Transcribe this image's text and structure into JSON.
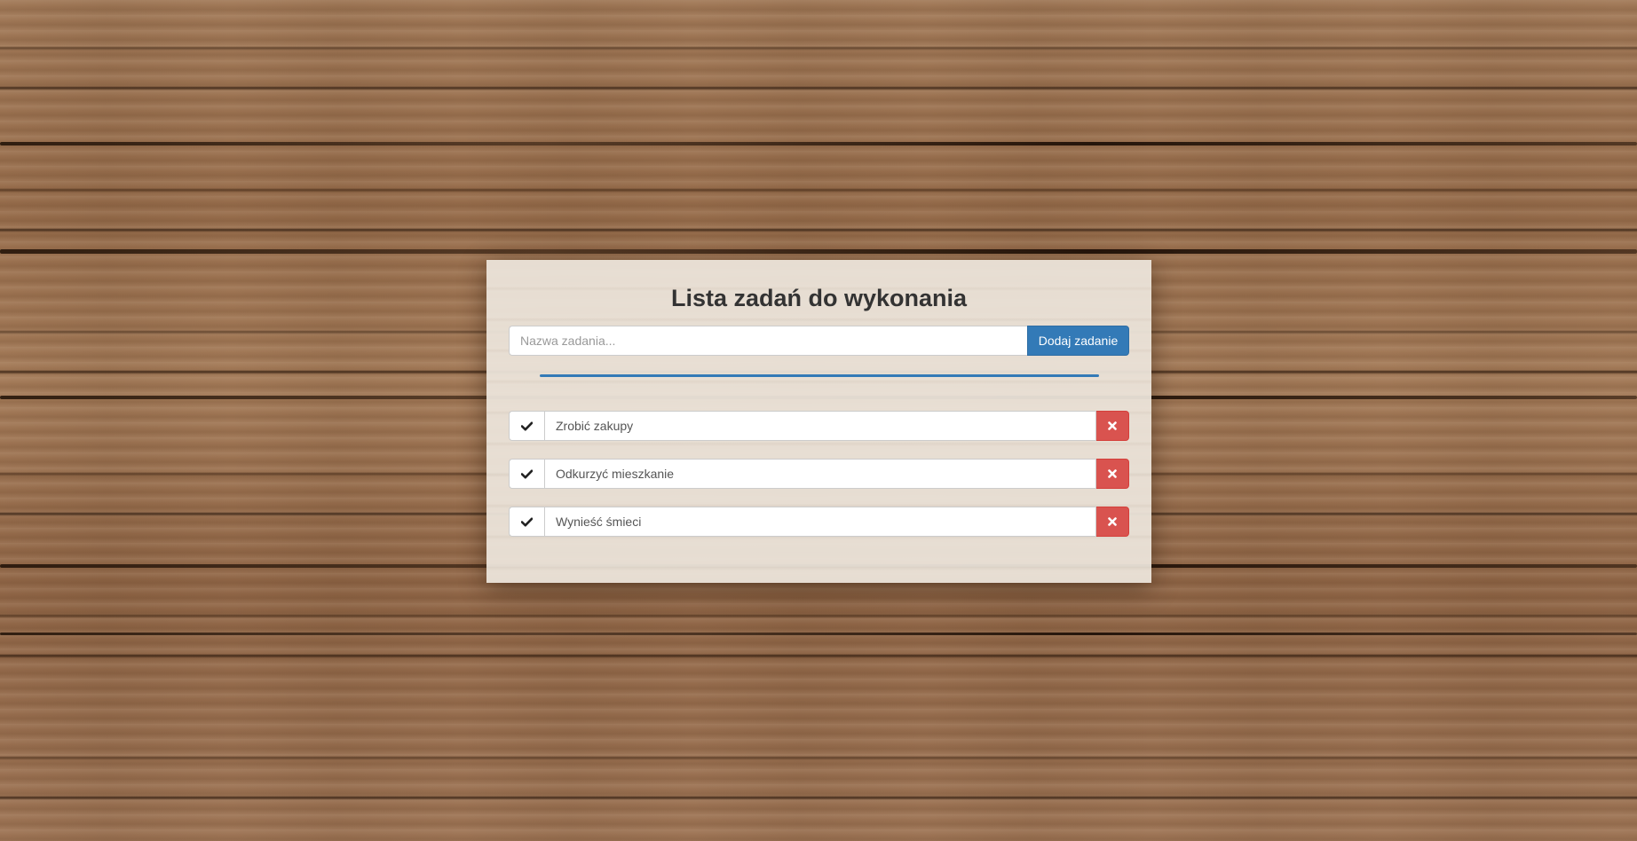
{
  "app": {
    "title": "Lista zadań do wykonania"
  },
  "add_form": {
    "placeholder": "Nazwa zadania...",
    "value": "",
    "button_label": "Dodaj zadanie"
  },
  "tasks": [
    {
      "label": "Zrobić zakupy"
    },
    {
      "label": "Odkurzyć mieszkanie"
    },
    {
      "label": "Wynieść śmieci"
    }
  ],
  "icons": {
    "complete": "check-icon",
    "delete": "close-icon"
  },
  "colors": {
    "primary": "#337ab7",
    "danger": "#d9534f",
    "text": "#333333"
  }
}
